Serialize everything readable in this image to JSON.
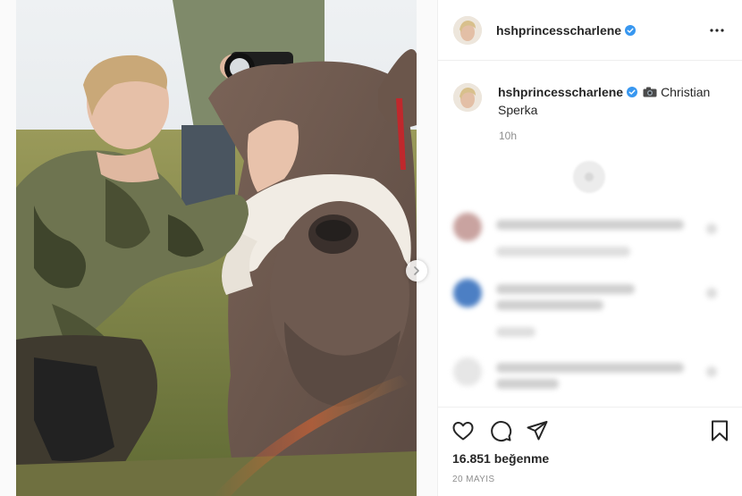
{
  "post": {
    "username": "hshprincesscharlene",
    "caption_credit": "Christian Sperka",
    "time_ago": "10h",
    "likes_text": "16.851 beğenme",
    "date_text": "20 MAYIS"
  },
  "icons": {
    "verified": "verified-badge-icon",
    "more": "more-options-icon",
    "camera": "camera-emoji-icon",
    "like": "heart-icon",
    "comment": "comment-bubble-icon",
    "share": "paper-plane-icon",
    "save": "bookmark-icon",
    "next": "chevron-right-icon"
  },
  "colors": {
    "verified_blue": "#3897f0",
    "text_primary": "#262626",
    "text_secondary": "#8e8e8e",
    "border": "#efefef"
  }
}
